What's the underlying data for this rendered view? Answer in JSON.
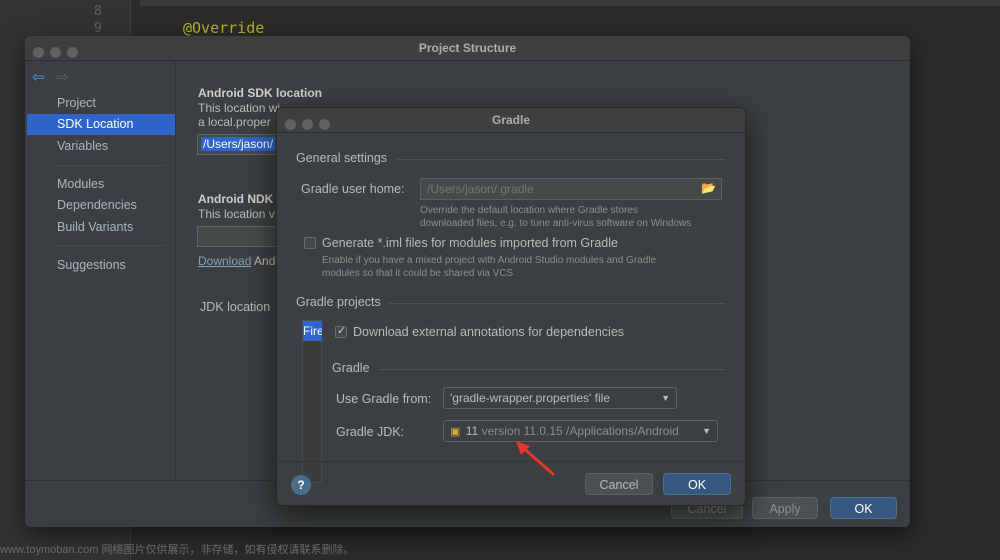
{
  "editor": {
    "line_numbers": [
      "8",
      "9"
    ],
    "code_line": "@Override"
  },
  "project_structure": {
    "title": "Project Structure",
    "sidebar": {
      "groups": [
        [
          "Project",
          "SDK Location",
          "Variables"
        ],
        [
          "Modules",
          "Dependencies",
          "Build Variants"
        ],
        [
          "Suggestions"
        ]
      ],
      "selected": "SDK Location"
    },
    "content": {
      "sdk_heading": "Android SDK location",
      "sdk_desc_1": "This location wi",
      "sdk_desc_2": "a local.proper",
      "sdk_path": "/Users/jason/",
      "ndk_heading": "Android NDK",
      "ndk_desc": "This location v",
      "download_link": "Download",
      "download_suffix": "And",
      "jdk_label": "JDK location"
    },
    "footer": {
      "cancel": "Cancel",
      "apply": "Apply",
      "ok": "OK"
    }
  },
  "gradle_dialog": {
    "title": "Gradle",
    "general_settings": "General settings",
    "user_home_label": "Gradle user home:",
    "user_home_value": "/Users/jason/.gradle",
    "user_home_desc_1": "Override the default location where Gradle stores",
    "user_home_desc_2": "downloaded files, e.g. to tune anti-virus software on Windows",
    "iml_label": "Generate *.iml files for modules imported from Gradle",
    "iml_checked": false,
    "iml_desc_1": "Enable if you have a mixed project with Android Studio modules and Gradle",
    "iml_desc_2": "modules so that it could be shared via VCS",
    "gradle_projects": "Gradle projects",
    "project_item": "Fire",
    "annotations_label": "Download external annotations for dependencies",
    "annotations_checked": true,
    "gradle_section": "Gradle",
    "use_gradle_from_label": "Use Gradle from:",
    "use_gradle_from_value": "'gradle-wrapper.properties' file",
    "gradle_jdk_label": "Gradle JDK:",
    "gradle_jdk_version": "11",
    "gradle_jdk_detail": "version 11.0.15 /Applications/Android",
    "cancel": "Cancel",
    "ok": "OK",
    "help": "?"
  },
  "watermark": "www.toymoban.com 网络图片仅供展示，非存储，如有侵权请联系删除。",
  "colors": {
    "selection": "#2f65ca",
    "primary_button": "#365880",
    "annotation_arrow": "#e8352a"
  }
}
